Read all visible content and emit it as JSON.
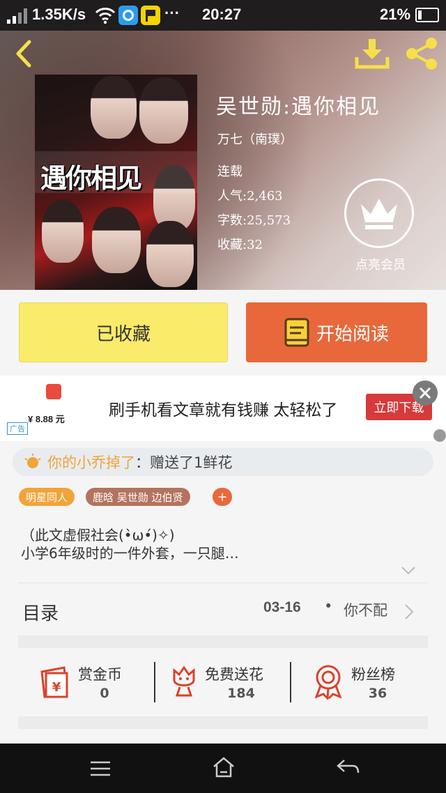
{
  "status_bar": {
    "speed": "1.35K/s",
    "dots": "···",
    "time": "20:27",
    "battery_percent": "21%",
    "battery_level": 0.21
  },
  "book": {
    "cover_title": "遇你相见",
    "title": "吴世勋:遇你相见",
    "author": "万七（南璞）",
    "status": "连载",
    "popularity": "人气:2,463",
    "word_count": "字数:25,573",
    "favorites": "收藏:32",
    "vip_label": "点亮会员"
  },
  "actions": {
    "favorited_label": "已收藏",
    "read_label": "开始阅读"
  },
  "ad": {
    "price": "¥ 8.88 元",
    "badge": "广告",
    "text": "刷手机看文章就有钱赚 太轻松了",
    "button": "立即下载"
  },
  "gift_feed": {
    "user": "你的小乔掉了",
    "action": "：赠送了1鲜花"
  },
  "tags": [
    "明星同人",
    "鹿晗 吴世勋 边伯贤",
    "+"
  ],
  "intro": {
    "line1": "（此文虚假社会(•̀ω•́)✧)",
    "line2": "小学6年级时的一件外套，一只腿…"
  },
  "toc": {
    "label": "目录",
    "date": "03-16",
    "bullet": "•",
    "latest": "你不配"
  },
  "stats": [
    {
      "label": "赏金币",
      "value": "0",
      "icon": "coin-envelope-icon"
    },
    {
      "label": "免费送花",
      "value": "184",
      "icon": "flower-icon"
    },
    {
      "label": "粉丝榜",
      "value": "36",
      "icon": "medal-icon"
    }
  ],
  "colors": {
    "accent_orange": "#e8683b",
    "favorite_yellow": "#fbeb6a",
    "tag_orange": "#f0a43a",
    "tag_brown": "#b4735e",
    "tag_plus": "#e8683b",
    "stat_icon_red": "#d9432b",
    "feed_orange": "#f0a43a"
  },
  "icons": {
    "back": "back-arrow-icon",
    "download": "download-icon",
    "share": "share-icon",
    "crown": "crown-icon",
    "book": "book-icon",
    "close": "close-icon",
    "bulb": "bulb-icon",
    "chevron_right": "chevron-right-icon",
    "chevron_down": "chevron-down-icon",
    "menu": "menu-icon",
    "home": "home-icon",
    "back_nav": "nav-back-icon"
  }
}
